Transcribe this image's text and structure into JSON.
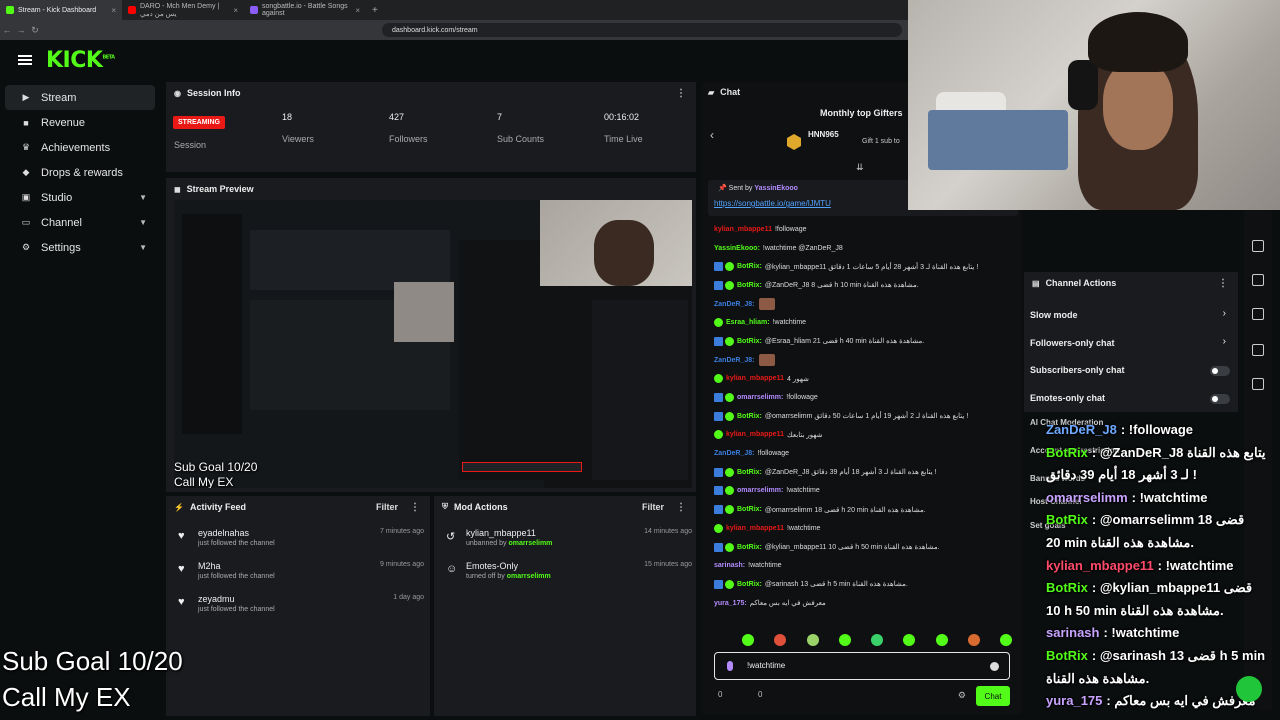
{
  "browser": {
    "tabs": [
      {
        "label": "Stream - Kick Dashboard",
        "color": "#53fc18",
        "active": true
      },
      {
        "label": "DARO - Mch Men Demy | يس من دمي",
        "color": "#ff0000",
        "active": false
      },
      {
        "label": "songbattle.io - Battle Songs against",
        "color": "#8b5cf6",
        "active": false
      }
    ],
    "url": "dashboard.kick.com/stream"
  },
  "logo": "KICK",
  "logo_sup": "BETA",
  "sidebar": {
    "items": [
      {
        "label": "Stream",
        "icon": "play-icon",
        "glyph": "▶",
        "chevron": false
      },
      {
        "label": "Revenue",
        "icon": "card-icon",
        "glyph": "■",
        "chevron": false
      },
      {
        "label": "Achievements",
        "icon": "trophy-icon",
        "glyph": "♛",
        "chevron": false
      },
      {
        "label": "Drops & rewards",
        "icon": "gift-icon",
        "glyph": "◆",
        "chevron": false
      },
      {
        "label": "Studio",
        "icon": "studio-icon",
        "glyph": "▣",
        "chevron": true
      },
      {
        "label": "Channel",
        "icon": "tv-icon",
        "glyph": "▭",
        "chevron": true
      },
      {
        "label": "Settings",
        "icon": "gear-icon",
        "glyph": "⚙",
        "chevron": true
      }
    ]
  },
  "session": {
    "title": "Session Info",
    "badge": "STREAMING",
    "session_label": "Session",
    "stats": [
      {
        "value": "18",
        "label": "Viewers"
      },
      {
        "value": "427",
        "label": "Followers"
      },
      {
        "value": "7",
        "label": "Sub Counts"
      },
      {
        "value": "00:16:02",
        "label": "Time Live"
      }
    ]
  },
  "preview": {
    "title": "Stream Preview",
    "overlay_line1": "Sub Goal 10/20",
    "overlay_line2": "Call My EX"
  },
  "activity": {
    "title": "Activity Feed",
    "filter": "Filter",
    "items": [
      {
        "name": "eyadelnahas",
        "desc": "just followed the channel",
        "time": "7 minutes ago"
      },
      {
        "name": "M2ha",
        "desc": "just followed the channel",
        "time": "9 minutes ago"
      },
      {
        "name": "zeyadmu",
        "desc": "just followed the channel",
        "time": "1 day ago"
      }
    ]
  },
  "mod": {
    "title": "Mod Actions",
    "filter": "Filter",
    "items": [
      {
        "name": "kylian_mbappe11",
        "desc": "unbanned by",
        "by": "omarrselimm",
        "time": "14 minutes ago"
      },
      {
        "name": "Emotes-Only",
        "desc": "turned off by",
        "by": "omarrselimm",
        "time": "15 minutes ago"
      }
    ]
  },
  "chat": {
    "title": "Chat",
    "gifters_title": "Monthly top Gifters",
    "gifter_name": "HNN965",
    "gifter_note": "Gift 1 sub to",
    "sent_by_label": "Sent by",
    "sent_by_user": "YassinEkooo",
    "pinned_link": "https://songbattle.io/game/lJMTU",
    "messages": [
      {
        "user": "kylian_mbappe11",
        "color": "#e91916",
        "badges": 0,
        "text": "!followage"
      },
      {
        "user": "YassinEkooo:",
        "color": "#53fc18",
        "badges": 0,
        "text": "!watchtime @ZanDeR_J8"
      },
      {
        "user": "BotRix:",
        "color": "#53fc18",
        "badges": 2,
        "text": "@kylian_mbappe11 يتابع هذه القناة لـ 3 أشهر 28 أيام 5 ساعات 1 دقائق !"
      },
      {
        "user": "BotRix:",
        "color": "#53fc18",
        "badges": 2,
        "text": "@ZanDeR_J8 قضى 8 h 10 min مشاهدة هذه القناة."
      },
      {
        "user": "ZanDeR_J8:",
        "color": "#3b7ddd",
        "badges": 0,
        "text": "",
        "emote": true
      },
      {
        "user": "Esraa_hliam:",
        "color": "#53fc18",
        "badges": 1,
        "text": "!watchtime"
      },
      {
        "user": "BotRix:",
        "color": "#53fc18",
        "badges": 2,
        "text": "@Esraa_hliam قضى 21 h 40 min مشاهدة هذه القناة."
      },
      {
        "user": "ZanDeR_J8:",
        "color": "#3b7ddd",
        "badges": 0,
        "text": "",
        "emote": true
      },
      {
        "user": "kylian_mbappe11",
        "color": "#e91916",
        "badges": 1,
        "text": "شهور 4"
      },
      {
        "user": "omarrselimm:",
        "color": "#b48cff",
        "badges": 2,
        "text": "!followage"
      },
      {
        "user": "BotRix:",
        "color": "#53fc18",
        "badges": 2,
        "text": "@omarrselimm يتابع هذه القناة لـ 2 أشهر 19 أيام 1 ساعات 50 دقائق !"
      },
      {
        "user": "kylian_mbappe11",
        "color": "#e91916",
        "badges": 1,
        "text": "شهور بتابعك"
      },
      {
        "user": "ZanDeR_J8:",
        "color": "#3b7ddd",
        "badges": 0,
        "text": "!followage"
      },
      {
        "user": "BotRix:",
        "color": "#53fc18",
        "badges": 2,
        "text": "@ZanDeR_J8 يتابع هذه القناة لـ 3 أشهر 18 أيام 39 دقائق !"
      },
      {
        "user": "omarrselimm:",
        "color": "#b48cff",
        "badges": 2,
        "text": "!watchtime"
      },
      {
        "user": "BotRix:",
        "color": "#53fc18",
        "badges": 2,
        "text": "@omarrselimm قضى 18 h 20 min مشاهدة هذه القناة."
      },
      {
        "user": "kylian_mbappe11",
        "color": "#e91916",
        "badges": 1,
        "text": "!watchtime"
      },
      {
        "user": "BotRix:",
        "color": "#53fc18",
        "badges": 2,
        "text": "@kylian_mbappe11 قضى 10 h 50 min مشاهدة هذه القناة."
      },
      {
        "user": "sarinash:",
        "color": "#b48cff",
        "badges": 0,
        "text": "!watchtime"
      },
      {
        "user": "BotRix:",
        "color": "#53fc18",
        "badges": 2,
        "text": "@sarinash قضى 13 h 5 min مشاهدة هذه القناة."
      },
      {
        "user": "yura_175:",
        "color": "#b48cff",
        "badges": 0,
        "text": "معرفش في ايه بس معاكم"
      }
    ],
    "input_value": "!watchtime",
    "points_left": "0",
    "points_right": "0",
    "send_label": "Chat",
    "emote_colors": [
      "#53fc18",
      "#e04f3a",
      "#9bd36a",
      "#53fc18",
      "#3ad16b",
      "#53fc18",
      "#53fc18",
      "#d86b2f",
      "#53fc18"
    ]
  },
  "channel_actions": {
    "title": "Channel Actions",
    "items": [
      {
        "label": "Slow mode",
        "kind": "arrow"
      },
      {
        "label": "Followers-only chat",
        "kind": "arrow"
      },
      {
        "label": "Subscribers-only chat",
        "kind": "toggle"
      },
      {
        "label": "Emotes-only chat",
        "kind": "toggle"
      }
    ],
    "partial": [
      "Al Chat Moderation",
      "Account age restriction",
      "Banned words",
      "Host Channel",
      "Set goals"
    ]
  },
  "overlay": {
    "sub_goal": "Sub Goal 10/20",
    "call": "Call My EX",
    "big_chat": [
      {
        "user": "ZanDeR_J8",
        "color": "#6ea8ff",
        "text": ": !followage"
      },
      {
        "user": "BotRix",
        "color": "#53fc18",
        "text": ": @ZanDeR_J8 يتابع هذه القناة"
      },
      {
        "user": "",
        "color": "#fff",
        "text": "لـ 3 أشهر 18 أيام 39 دقائق !"
      },
      {
        "user": "omarrselimm",
        "color": "#c8a3ff",
        "text": ": !watchtime"
      },
      {
        "user": "BotRix",
        "color": "#53fc18",
        "text": ": @omarrselimm 18 قضى"
      },
      {
        "user": "",
        "color": "#fff",
        "text": "20 min مشاهدة هذه القناة."
      },
      {
        "user": "kylian_mbappe11",
        "color": "#ff4a6a",
        "text": ": !watchtime"
      },
      {
        "user": "BotRix",
        "color": "#53fc18",
        "text": ": @kylian_mbappe11 قضى"
      },
      {
        "user": "",
        "color": "#fff",
        "text": "10 h 50 min مشاهدة هذه القناة."
      },
      {
        "user": "sarinash",
        "color": "#c8a3ff",
        "text": ": !watchtime"
      },
      {
        "user": "BotRix",
        "color": "#53fc18",
        "text": ": @sarinash 13 قضى h 5 min"
      },
      {
        "user": "",
        "color": "#fff",
        "text": "مشاهدة هذه القناة."
      },
      {
        "user": "yura_175",
        "color": "#c8a3ff",
        "text": ": معرفش في ايه بس معاكم"
      }
    ]
  }
}
